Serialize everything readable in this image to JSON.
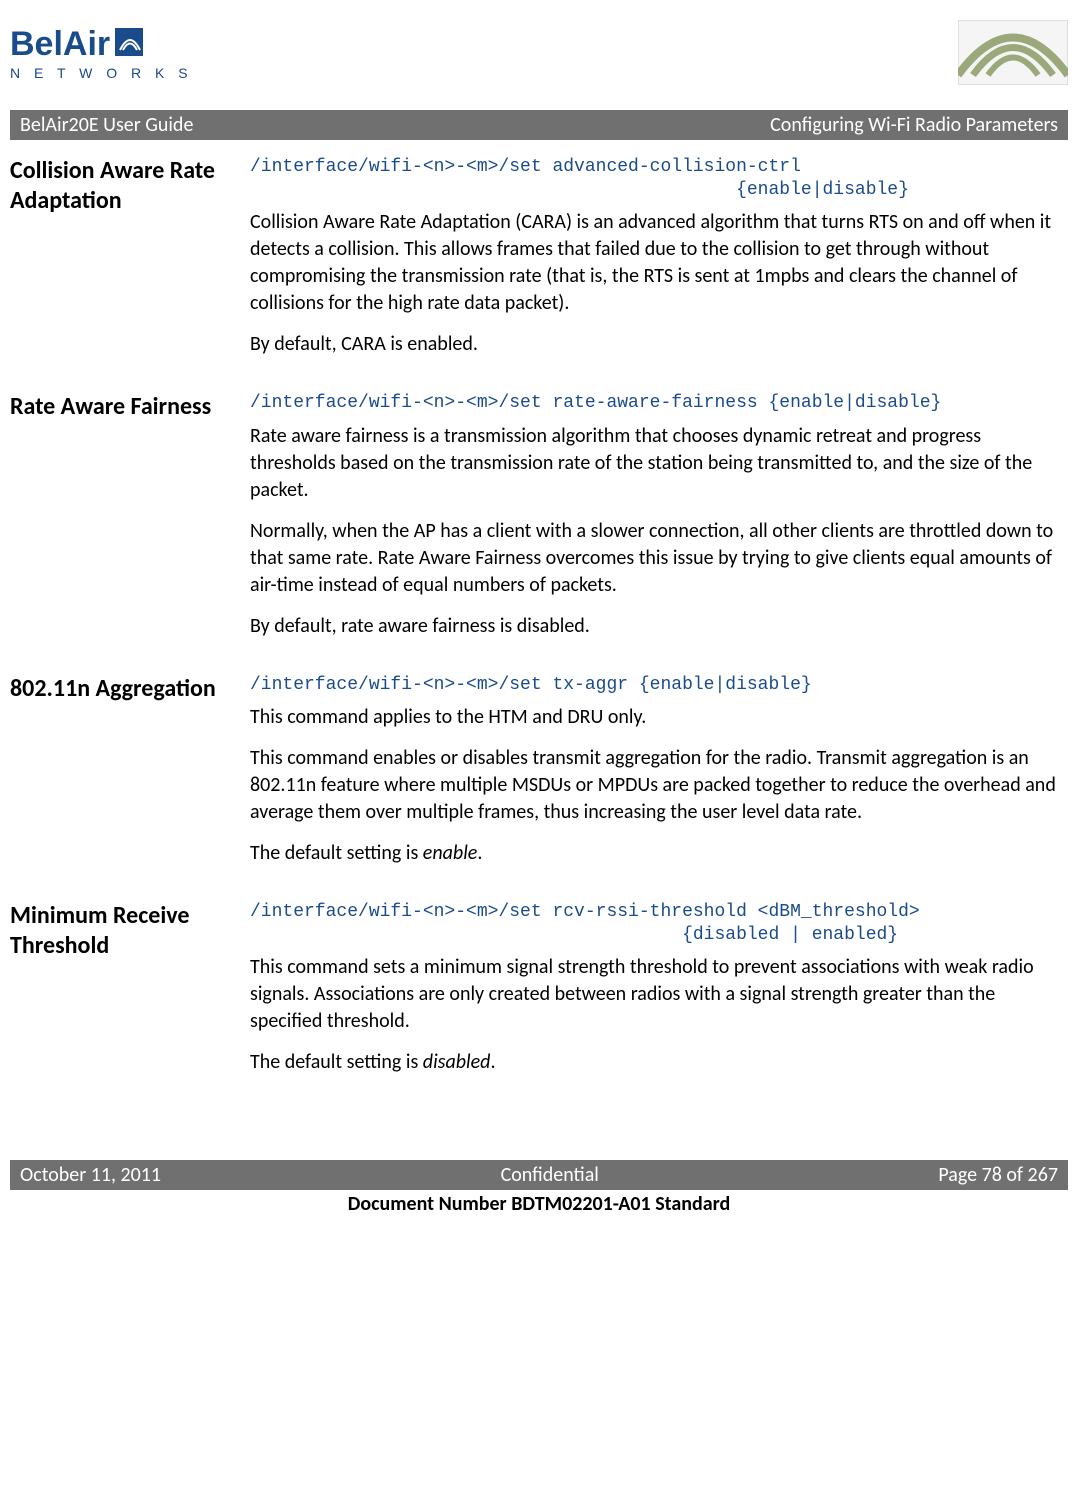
{
  "header": {
    "guide_title": "BelAir20E User Guide",
    "chapter_title": "Configuring Wi-Fi Radio Parameters"
  },
  "sections": {
    "cara": {
      "heading": "Collision Aware Rate Adaptation",
      "code": "/interface/wifi-<n>-<m>/set advanced-collision-ctrl\n                                             {enable|disable}",
      "p1": "Collision Aware Rate Adaptation (CARA) is an advanced algorithm that turns RTS on and off when it detects a collision. This allows frames that failed due to the collision to get through without compromising the transmission rate (that is, the RTS is sent at 1mpbs and clears the channel of collisions for the high rate data packet).",
      "p2": "By default, CARA is enabled."
    },
    "raf": {
      "heading": "Rate Aware Fairness",
      "code": "/interface/wifi-<n>-<m>/set rate-aware-fairness {enable|disable}",
      "p1": "Rate aware fairness is a transmission algorithm that chooses dynamic retreat and progress thresholds based on the transmission rate of the station being transmitted to, and the size of the packet.",
      "p2": "Normally, when the AP has a client with a slower connection, all other clients are throttled down to that same rate. Rate Aware Fairness overcomes this issue by trying to give clients equal amounts of air-time instead of equal numbers of packets.",
      "p3": "By default, rate aware fairness is disabled."
    },
    "aggr": {
      "heading": "802.11n Aggregation",
      "code": "/interface/wifi-<n>-<m>/set tx-aggr {enable|disable}",
      "p1": "This command applies to the HTM and DRU only.",
      "p2": "This command enables or disables transmit aggregation for the radio. Transmit aggregation is an 802.11n feature where multiple MSDUs or MPDUs are packed together to reduce the overhead and average them over multiple frames, thus increasing the user level data rate.",
      "p3_prefix": "The default setting is ",
      "p3_em": "enable",
      "p3_suffix": "."
    },
    "mrt": {
      "heading": "Minimum Receive Threshold",
      "code": "/interface/wifi-<n>-<m>/set rcv-rssi-threshold <dBM_threshold>\n                                        {disabled | enabled}",
      "p1": "This command sets a minimum signal strength threshold to prevent associations with weak radio signals. Associations are only created between radios with a signal strength greater than the specified threshold.",
      "p2_prefix": "The default setting is ",
      "p2_em": "disabled",
      "p2_suffix": "."
    }
  },
  "footer": {
    "date": "October 11, 2011",
    "confidential": "Confidential",
    "page": "Page 78 of 267",
    "docnum": "Document Number BDTM02201-A01 Standard"
  }
}
